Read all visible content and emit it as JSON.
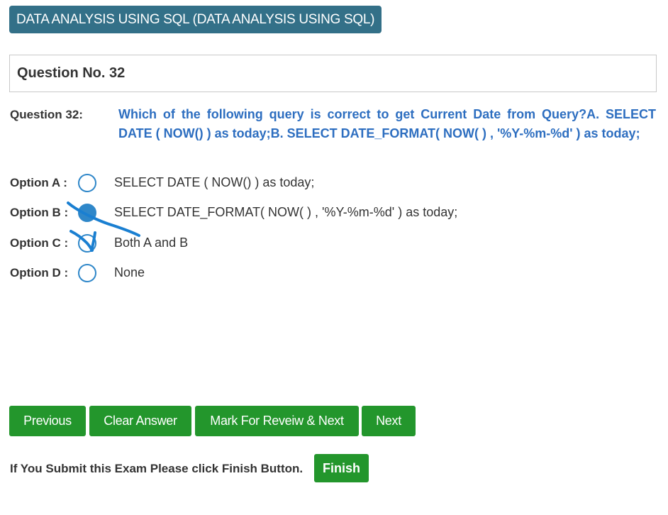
{
  "header": {
    "subject": "DATA ANALYSIS USING SQL (DATA ANALYSIS USING SQL)"
  },
  "question": {
    "panel_title": "Question No. 32",
    "label": "Question 32:",
    "text": "Which of the following query is correct to get Current Date from Query?A. SELECT DATE ( NOW() ) as today;B. SELECT DATE_FORMAT( NOW( ) , '%Y-%m-%d' ) as today;"
  },
  "options": [
    {
      "label": "Option A :",
      "text": "SELECT DATE ( NOW() ) as today;",
      "selected": false
    },
    {
      "label": "Option B :",
      "text": "SELECT DATE_FORMAT( NOW( ) , '%Y-%m-%d' ) as today;",
      "selected": true
    },
    {
      "label": "Option C :",
      "text": "Both A and B",
      "selected": false
    },
    {
      "label": "Option D :",
      "text": "None",
      "selected": false
    }
  ],
  "buttons": {
    "previous": "Previous",
    "clear": "Clear Answer",
    "mark_review": "Mark For Reveiw & Next",
    "next": "Next",
    "finish": "Finish"
  },
  "footer": {
    "submit_note": "If You Submit this Exam Please click Finish Button."
  },
  "colors": {
    "badge": "#337088",
    "question_text": "#2d6ec0",
    "radio": "#2f87c9",
    "button": "#23962c",
    "pen_annotation": "#1a7fd1"
  }
}
